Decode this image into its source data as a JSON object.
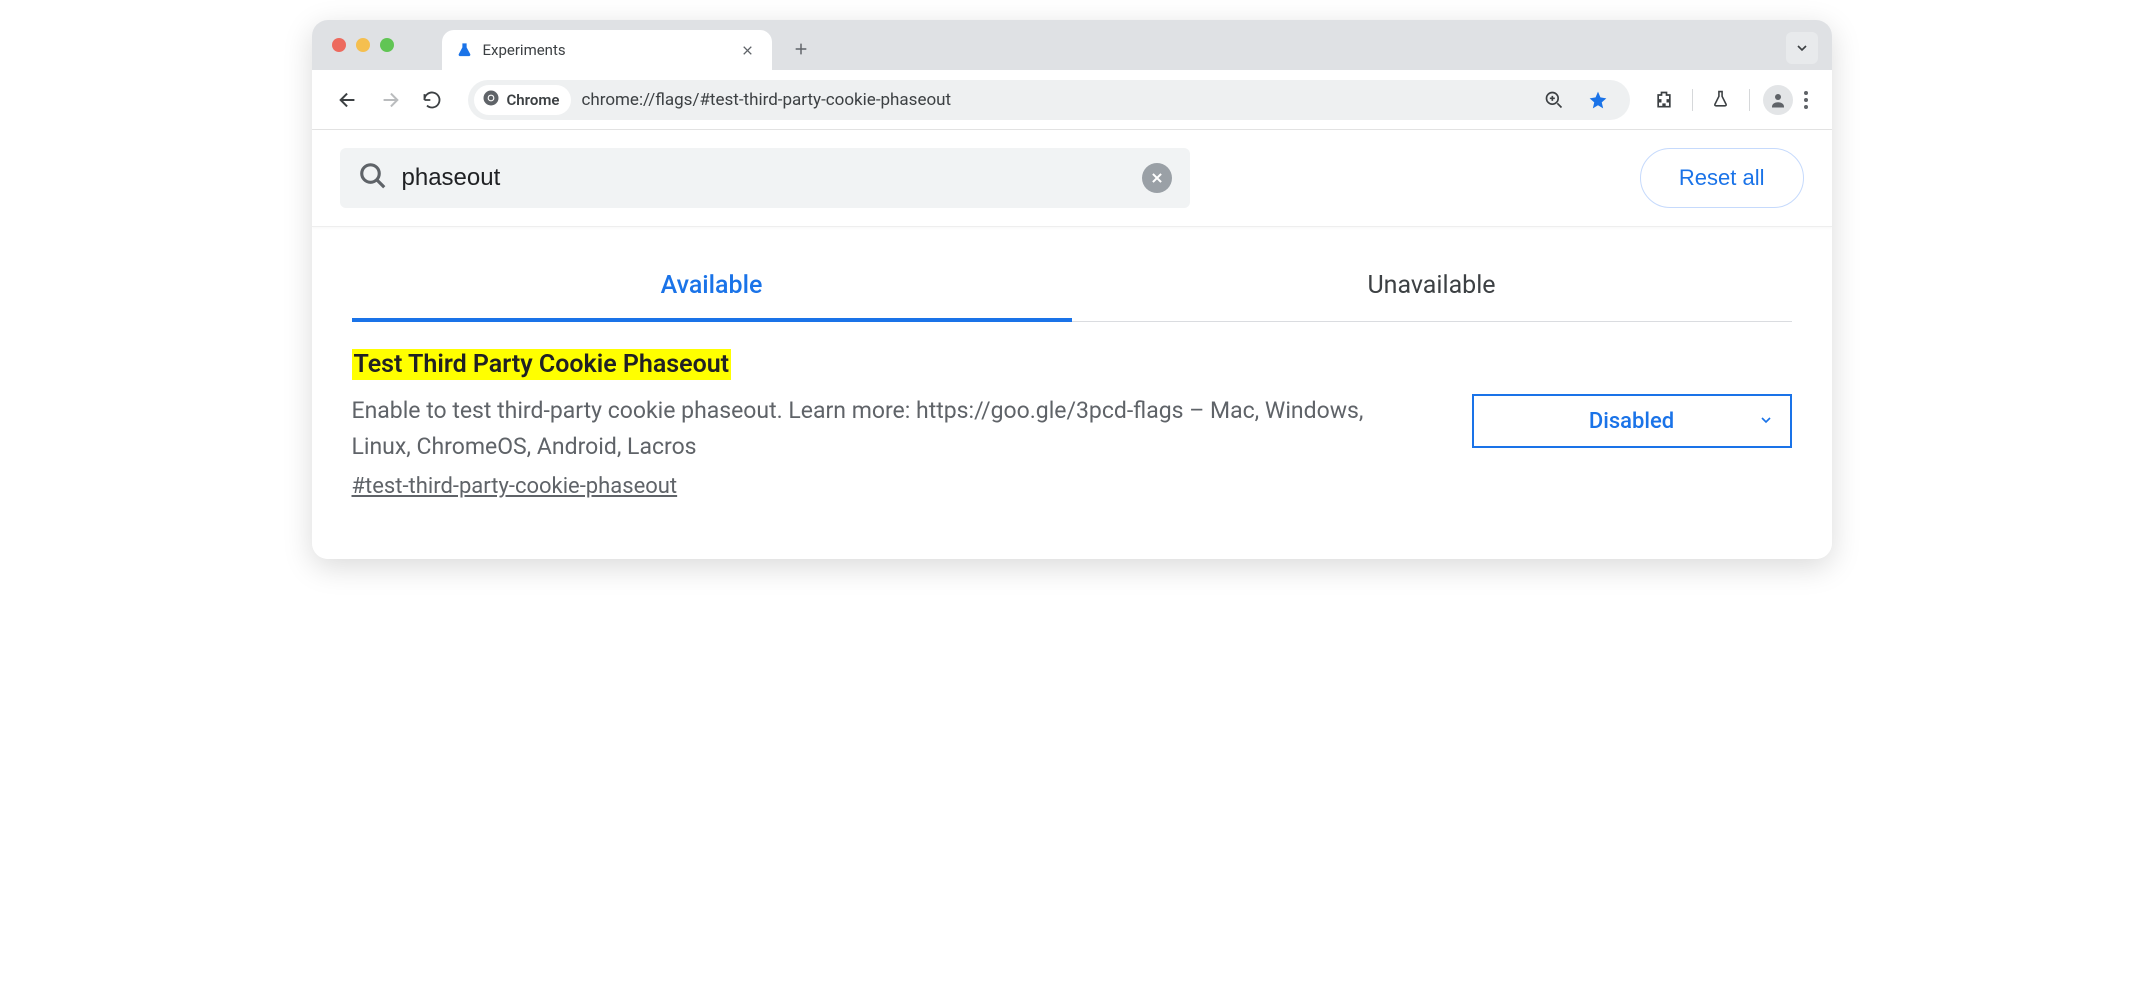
{
  "browser": {
    "tab_title": "Experiments",
    "url": "chrome://flags/#test-third-party-cookie-phaseout",
    "chip_label": "Chrome"
  },
  "search": {
    "value": "phaseout",
    "reset_label": "Reset all"
  },
  "tabs": {
    "available": "Available",
    "unavailable": "Unavailable"
  },
  "flag": {
    "title": "Test Third Party Cookie Phaseout",
    "description": "Enable to test third-party cookie phaseout. Learn more: https://goo.gle/3pcd-flags – Mac, Windows, Linux, ChromeOS, Android, Lacros",
    "anchor": "#test-third-party-cookie-phaseout",
    "selected": "Disabled"
  }
}
